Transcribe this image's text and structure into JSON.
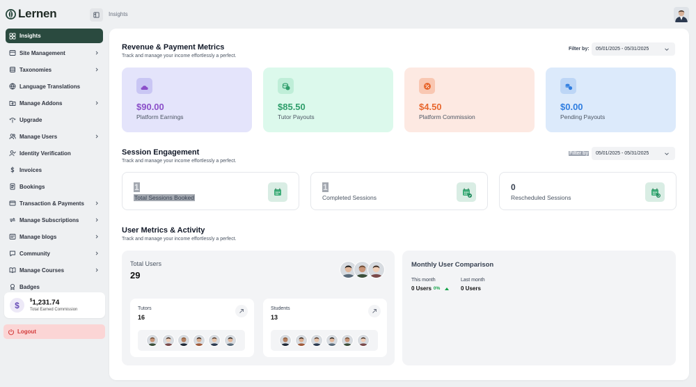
{
  "app": {
    "name": "Lernen"
  },
  "breadcrumb": "Insights",
  "sidebar": {
    "items": [
      {
        "label": "Insights",
        "icon": "grid-icon",
        "active": true,
        "chevron": false
      },
      {
        "label": "Site Management",
        "icon": "gear-icon",
        "chevron": true
      },
      {
        "label": "Taxonomies",
        "icon": "layers-icon",
        "chevron": true
      },
      {
        "label": "Language Translations",
        "icon": "globe-icon",
        "chevron": false
      },
      {
        "label": "Manage Addons",
        "icon": "folder-icon",
        "chevron": true
      },
      {
        "label": "Upgrade",
        "icon": "upgrade-icon",
        "chevron": false
      },
      {
        "label": "Manage Users",
        "icon": "users-icon",
        "chevron": true
      },
      {
        "label": "Identity Verification",
        "icon": "user-check-icon",
        "chevron": false
      },
      {
        "label": "Invoices",
        "icon": "dollar-icon",
        "chevron": false
      },
      {
        "label": "Bookings",
        "icon": "document-icon",
        "chevron": false
      },
      {
        "label": "Transaction & Payments",
        "icon": "credit-card-icon",
        "chevron": true
      },
      {
        "label": "Manage Subscriptions",
        "icon": "refresh-icon",
        "chevron": true
      },
      {
        "label": "Manage blogs",
        "icon": "blog-icon",
        "chevron": true
      },
      {
        "label": "Community",
        "icon": "chat-icon",
        "chevron": true
      },
      {
        "label": "Manage Courses",
        "icon": "book-icon",
        "chevron": true
      },
      {
        "label": "Badges",
        "icon": "badge-icon",
        "chevron": false
      }
    ],
    "commission": {
      "currency": "$",
      "amount": "1,231.74",
      "label": "Total Earned Commission"
    },
    "logout": "Logout"
  },
  "revenue": {
    "title": "Revenue & Payment Metrics",
    "subtitle": "Track and manage your income effortlessly a perfect.",
    "filter_label": "Filter by:",
    "filter_value": "05/01/2025 - 05/31/2025",
    "cards": [
      {
        "value": "$90.00",
        "label": "Platform Earnings",
        "bg": "#e4e4fb",
        "color": "#8b4fc9",
        "icon_bg": "#c9c6f4",
        "icon": "cloud-icon"
      },
      {
        "value": "$85.50",
        "label": "Tutor Payouts",
        "bg": "#dcf9ec",
        "color": "#2f9e6b",
        "icon_bg": "#bfeed8",
        "icon": "coins-icon"
      },
      {
        "value": "$4.50",
        "label": "Platform Commission",
        "bg": "#fde9e2",
        "color": "#e8672e",
        "icon_bg": "#f9c7b2",
        "icon": "percent-icon"
      },
      {
        "value": "$0.00",
        "label": "Pending Payouts",
        "bg": "#dceafb",
        "color": "#2f7de0",
        "icon_bg": "#bdd6f6",
        "icon": "pending-coins-icon"
      }
    ]
  },
  "sessions": {
    "title": "Session Engagement",
    "subtitle": "Track and manage your income effortlessly a perfect.",
    "filter_label": "Filter by",
    "filter_value": "05/01/2025 - 05/31/2025",
    "cards": [
      {
        "value": "1",
        "label": "Total Sessions Booked",
        "icon": "calendar-icon"
      },
      {
        "value": "1",
        "label": "Completed Sessions",
        "icon": "calendar-check-icon"
      },
      {
        "value": "0",
        "label": "Rescheduled Sessions",
        "icon": "calendar-refresh-icon"
      }
    ]
  },
  "users": {
    "title": "User Metrics & Activity",
    "subtitle": "Track and manage your income effortlessly a perfect.",
    "total_label": "Total Users",
    "total_value": "29",
    "tutors": {
      "label": "Tutors",
      "value": "16"
    },
    "students": {
      "label": "Students",
      "value": "13"
    },
    "comparison": {
      "title": "Monthly User Comparison",
      "this_month_label": "This month",
      "this_month_value": "0 Users",
      "this_month_change": "0%",
      "last_month_label": "Last month",
      "last_month_value": "0 Users"
    }
  }
}
